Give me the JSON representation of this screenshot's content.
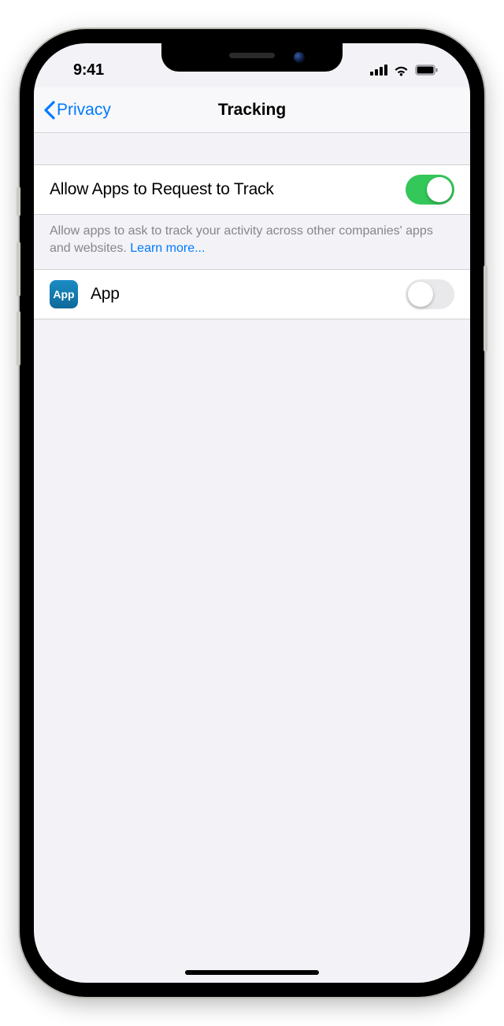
{
  "status": {
    "time": "9:41"
  },
  "nav": {
    "back": "Privacy",
    "title": "Tracking"
  },
  "main_toggle": {
    "label": "Allow Apps to Request to Track",
    "on": true
  },
  "footer": {
    "text": "Allow apps to ask to track your activity across other companies' apps and websites. ",
    "link": "Learn more..."
  },
  "apps": [
    {
      "name": "App",
      "icon_text": "App",
      "on": false
    }
  ]
}
